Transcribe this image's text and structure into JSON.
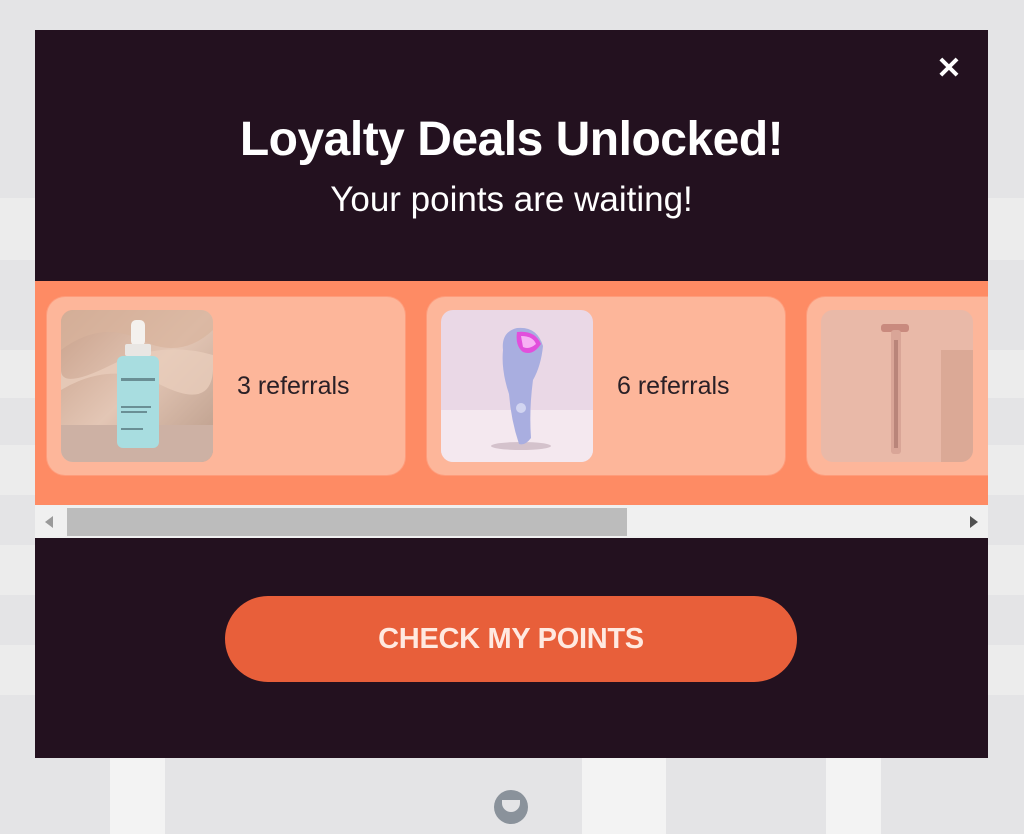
{
  "modal": {
    "title": "Loyalty Deals Unlocked!",
    "subtitle": "Your points are waiting!",
    "close_label": "✕",
    "cta_label": "CHECK MY POINTS"
  },
  "rewards": [
    {
      "label": "3 referrals",
      "product": "serum bottle"
    },
    {
      "label": "6 referrals",
      "product": "facial wand device"
    },
    {
      "label": "",
      "product": "light therapy wand"
    }
  ],
  "scrollbar": {
    "position_fraction": 0.0,
    "visible_fraction": 0.63
  },
  "colors": {
    "modal_bg": "#23111f",
    "carousel_bg": "#fe8b64",
    "card_bg": "#fdb69a",
    "cta_bg": "#e85f3a"
  }
}
